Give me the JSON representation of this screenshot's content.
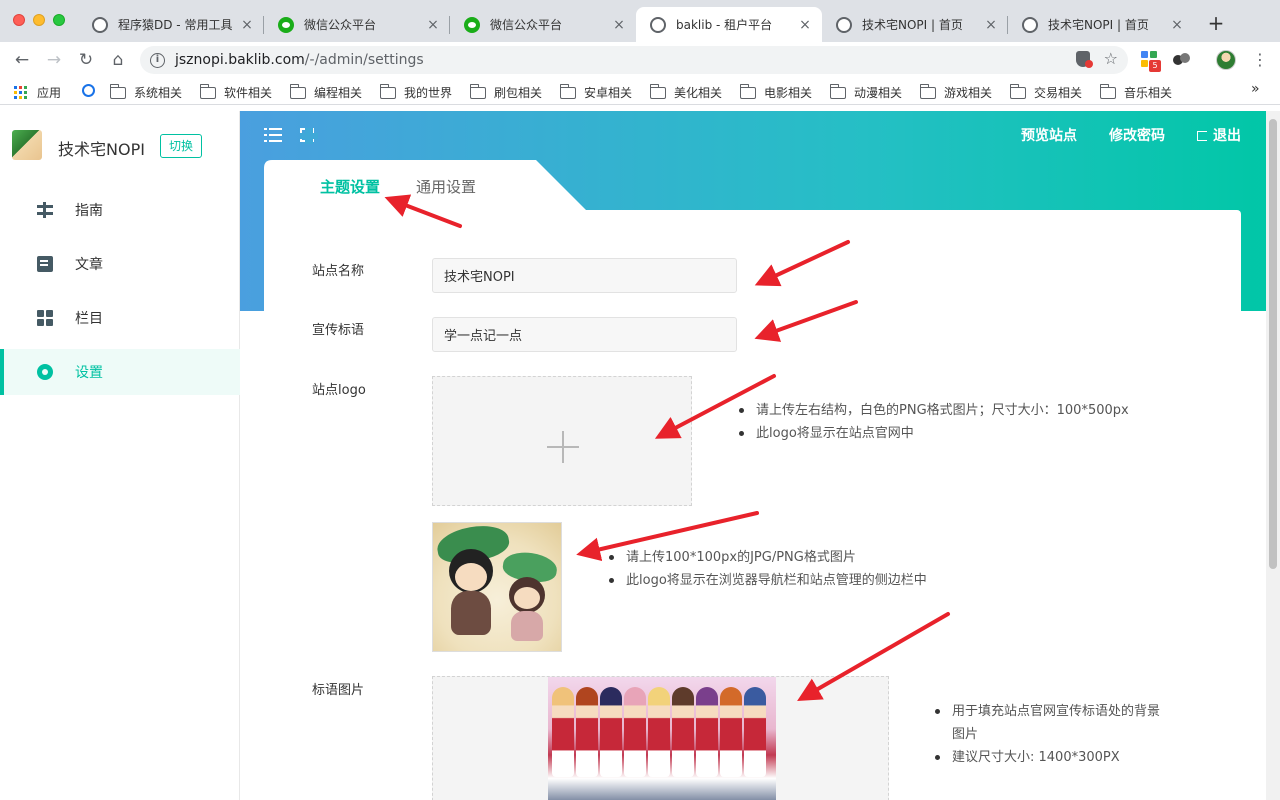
{
  "browser": {
    "tabs": [
      {
        "label": "程序猿DD - 常用工具",
        "icon": "globe-icon"
      },
      {
        "label": "微信公众平台",
        "icon": "wechat-icon"
      },
      {
        "label": "微信公众平台",
        "icon": "wechat-icon"
      },
      {
        "label": "baklib - 租户平台",
        "icon": "globe-icon",
        "active": true
      },
      {
        "label": "技术宅NOPI | 首页",
        "icon": "globe-icon"
      },
      {
        "label": "技术宅NOPI | 首页",
        "icon": "globe-icon"
      }
    ],
    "url_host": "jsznopi.baklib.com",
    "url_path": "/-/admin/settings",
    "extension_badge": "5",
    "bookmarks": [
      "应用",
      "",
      "系统相关",
      "软件相关",
      "编程相关",
      "我的世界",
      "刷包相关",
      "安卓相关",
      "美化相关",
      "电影相关",
      "动漫相关",
      "游戏相关",
      "交易相关",
      "音乐相关"
    ]
  },
  "sidebar": {
    "site_name": "技术宅NOPI",
    "switch_label": "切换",
    "items": [
      {
        "label": "指南",
        "icon": "guide-icon"
      },
      {
        "label": "文章",
        "icon": "article-icon"
      },
      {
        "label": "栏目",
        "icon": "column-icon"
      },
      {
        "label": "设置",
        "icon": "settings-icon",
        "active": true
      }
    ]
  },
  "header": {
    "preview_label": "预览站点",
    "change_password_label": "修改密码",
    "logout_label": "退出"
  },
  "tabs": {
    "theme_label": "主题设置",
    "general_label": "通用设置"
  },
  "form": {
    "site_name_label": "站点名称",
    "site_name_value": "技术宅NOPI",
    "slogan_label": "宣传标语",
    "slogan_value": "学一点记一点",
    "logo_label": "站点logo",
    "logo_hints": [
      "请上传左右结构，白色的PNG格式图片；尺寸大小：100*500px",
      "此logo将显示在站点官网中"
    ],
    "favicon_hints": [
      "请上传100*100px的JPG/PNG格式图片",
      "此logo将显示在浏览器导航栏和站点管理的侧边栏中"
    ],
    "slogan_image_label": "标语图片",
    "slogan_image_hints": [
      "用于填充站点官网宣传标语处的背景图片",
      "建议尺寸大小: 1400*300PX"
    ]
  },
  "colors": {
    "accent": "#00c1a2",
    "header_gradient_start": "#4a9fdf",
    "header_gradient_end": "#00c7a6",
    "annotation_arrow": "#e8222b"
  }
}
